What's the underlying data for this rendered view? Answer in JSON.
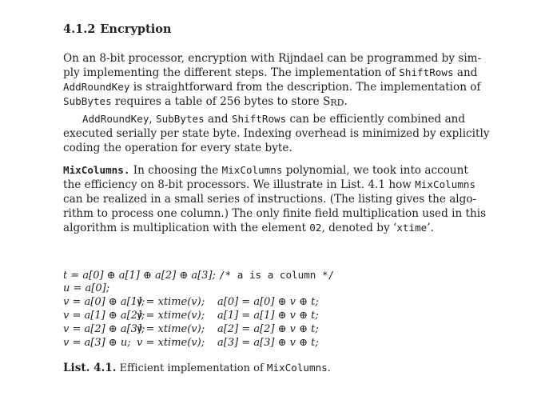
{
  "section": {
    "number": "4.1.2",
    "title": "Encryption"
  },
  "p1": {
    "l1": "On an 8-bit processor, encryption with Rijndael can be programmed by sim-",
    "l2": "ply implementing the different steps. The implementation of",
    "l2_code": "ShiftRows",
    "l2_end": "and",
    "l3_code": "AddRoundKey",
    "l3": "is straightforward from the description. The implementation of",
    "l4_code": "SubBytes",
    "l4": "requires a table of 256 bytes to store S",
    "l4_sub": "RD",
    "l4_end": "."
  },
  "p2": {
    "c1": "AddRoundKey",
    "t1": ", ",
    "c2": "SubBytes",
    "t2": " and ",
    "c3": "ShiftRows",
    "t3": " can be efficiently combined and",
    "l2": "executed serially per state byte. Indexing overhead is minimized by explicitly",
    "l3": "coding the operation for every state byte."
  },
  "p3": {
    "head": "MixColumns.",
    "l1": "In choosing the",
    "l1_code": "MixColumns",
    "l1_end": "polynomial, we took into account",
    "l2": "the efficiency on 8-bit processors. We illustrate in List. 4.1 how",
    "l2_code": "MixColumns",
    "l3": "can be realized in a small series of instructions. (The listing gives the algo-",
    "l4": "rithm to process one column.) The only finite field multiplication used in this",
    "l5": "algorithm is multiplication with the element",
    "l5_code": "02",
    "l5_mid": ", denoted by ‘",
    "l5_code2": "xtime",
    "l5_end": "’."
  },
  "listing": {
    "line1": "t = a[0] ⊕ a[1] ⊕ a[2] ⊕ a[3];",
    "line1_comment": "/* a is a column */",
    "line2": "u = a[0];",
    "rows": [
      {
        "a": "v = a[0] ⊕ a[1];",
        "b": "v = xtime(v);",
        "c": "a[0] = a[0] ⊕ v ⊕ t;"
      },
      {
        "a": "v = a[1] ⊕ a[2];",
        "b": "v = xtime(v);",
        "c": "a[1] = a[1] ⊕ v ⊕ t;"
      },
      {
        "a": "v = a[2] ⊕ a[3];",
        "b": "v = xtime(v);",
        "c": "a[2] = a[2] ⊕ v ⊕ t;"
      },
      {
        "a": "v = a[3] ⊕ u;",
        "b": "v = xtime(v);",
        "c": "a[3] = a[3] ⊕ v ⊕ t;"
      }
    ]
  },
  "caption": {
    "label": "List. 4.1.",
    "text": "Efficient implementation of",
    "code": "MixColumns",
    "end": "."
  }
}
